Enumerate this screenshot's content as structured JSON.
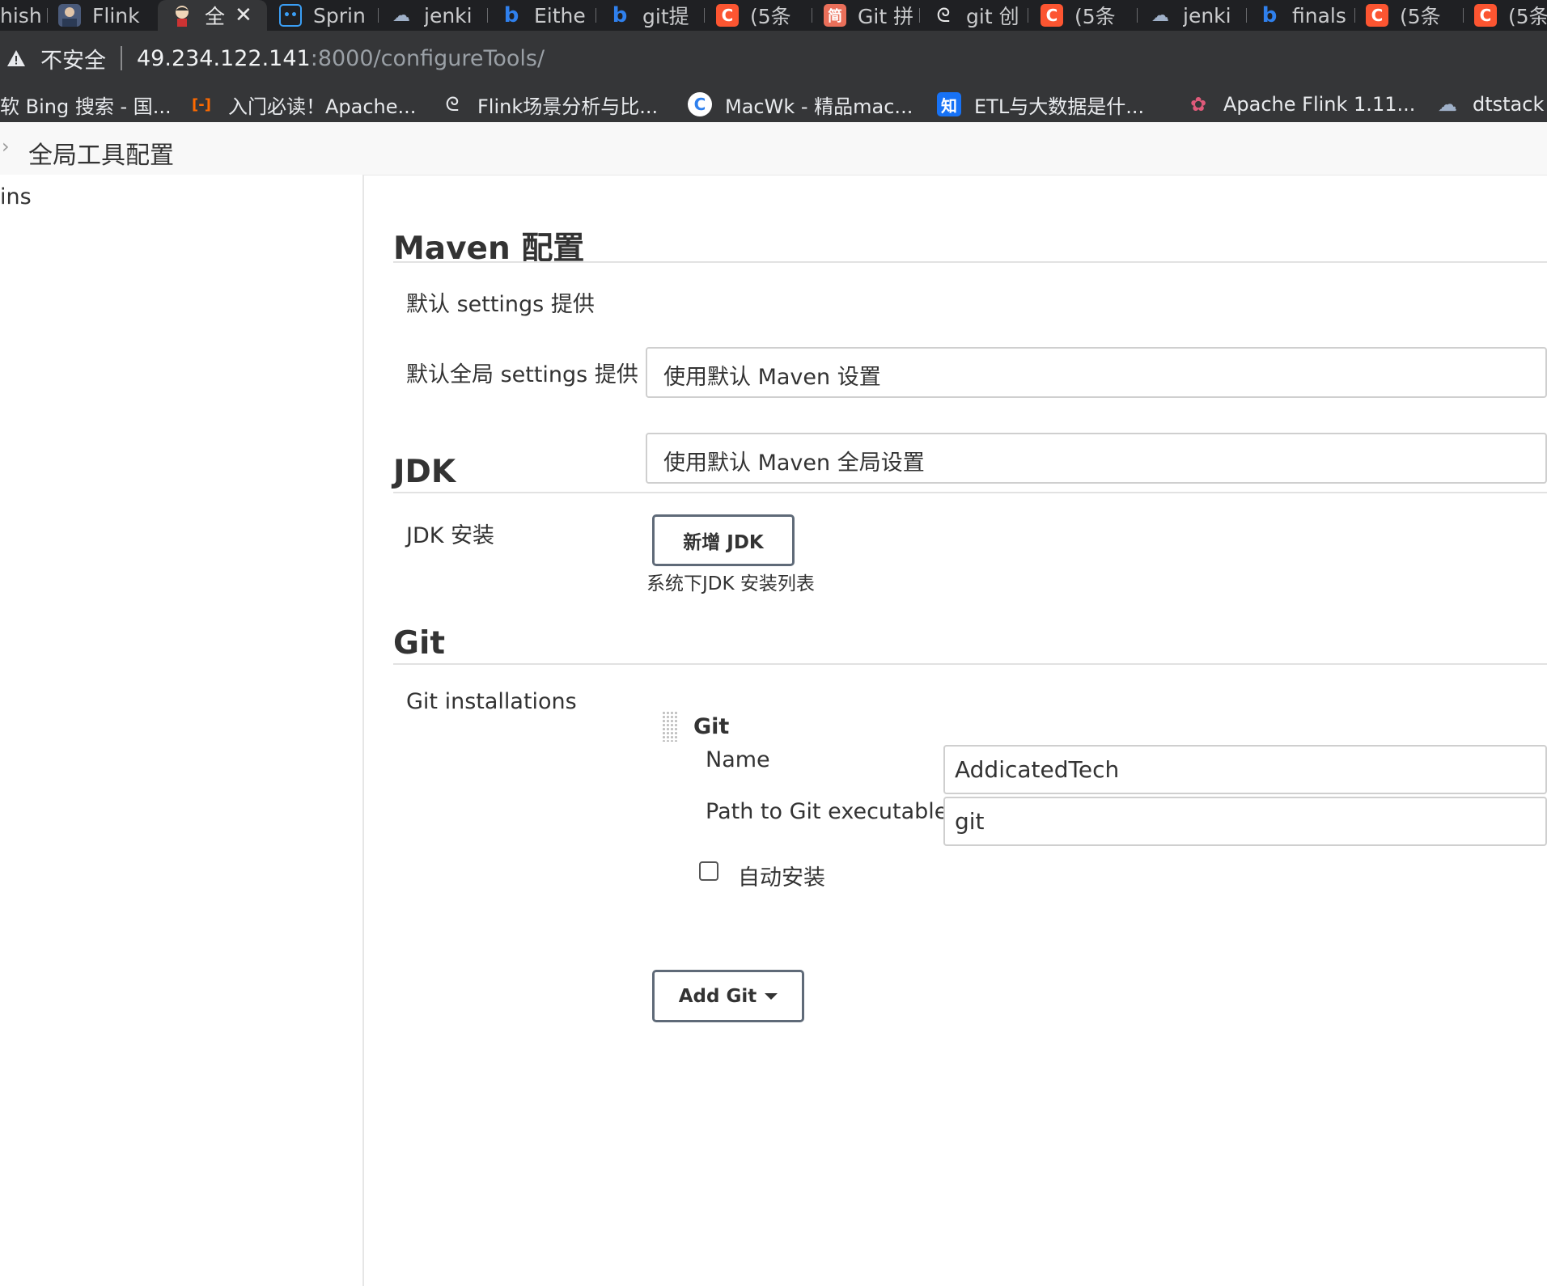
{
  "browser": {
    "tabs": [
      {
        "title": "hish",
        "icon": "page-icon",
        "icon_text": ""
      },
      {
        "title": "Flink",
        "icon": "avatar-icon",
        "icon_text": ""
      },
      {
        "title": "全",
        "icon": "jenkins-icon",
        "icon_text": "",
        "active": true
      },
      {
        "title": "Sprin",
        "icon": "bilibili-icon",
        "icon_text": "▣"
      },
      {
        "title": "jenki",
        "icon": "cloud-icon",
        "icon_text": "☁"
      },
      {
        "title": "Eithe",
        "icon": "bing-icon",
        "icon_text": "b"
      },
      {
        "title": "git提",
        "icon": "bing-icon",
        "icon_text": "b"
      },
      {
        "title": "(5条",
        "icon": "csdn-icon",
        "icon_text": "C"
      },
      {
        "title": "Git 拼",
        "icon": "jianshu-icon",
        "icon_text": "简"
      },
      {
        "title": "git 创",
        "icon": "flink-icon",
        "icon_text": "ᘓ"
      },
      {
        "title": "(5条",
        "icon": "csdn-icon",
        "icon_text": "C"
      },
      {
        "title": "jenki",
        "icon": "cloud-icon",
        "icon_text": "☁"
      },
      {
        "title": "finals",
        "icon": "bing-icon",
        "icon_text": "b"
      },
      {
        "title": "(5条",
        "icon": "csdn-icon",
        "icon_text": "C"
      },
      {
        "title": "(5条",
        "icon": "csdn-icon",
        "icon_text": "C"
      }
    ],
    "close_glyph": "✕",
    "address": {
      "insecure_label": "不安全",
      "host": "49.234.122.141",
      "rest": ":8000/configureTools/"
    },
    "bookmarks": [
      {
        "label": "软 Bing 搜索 - 国...",
        "icon": "",
        "icon_text": ""
      },
      {
        "label": "入门必读！Apache...",
        "icon": "aliyun-icon",
        "icon_text": "[-]"
      },
      {
        "label": "Flink场景分析与比...",
        "icon": "flink-icon",
        "icon_text": "ᘓ"
      },
      {
        "label": "MacWk - 精品mac...",
        "icon": "macwk-icon",
        "icon_text": "C"
      },
      {
        "label": "ETL与大数据是什...",
        "icon": "zhihu-icon",
        "icon_text": "知"
      },
      {
        "label": "Apache Flink 1.11...",
        "icon": "flink-squirrel-icon",
        "icon_text": "✿"
      },
      {
        "label": "dtstack",
        "icon": "cloud-icon",
        "icon_text": "☁"
      }
    ]
  },
  "header": {
    "breadcrumb_title": "全局工具配置",
    "chevron": "›"
  },
  "sidebar": {
    "text": "ins"
  },
  "maven": {
    "title": "Maven 配置",
    "settings_label": "默认 settings 提供",
    "settings_value": "使用默认 Maven 设置",
    "global_settings_label": "默认全局 settings 提供",
    "global_settings_value": "使用默认 Maven 全局设置"
  },
  "jdk": {
    "title": "JDK",
    "install_label": "JDK 安装",
    "add_button": "新增 JDK",
    "help": "系统下JDK 安装列表"
  },
  "git": {
    "title": "Git",
    "installations_label": "Git installations",
    "block_title": "Git",
    "name_label": "Name",
    "name_value": "AddicatedTech",
    "path_label": "Path to Git executable",
    "path_value": "git",
    "auto_install_label": "自动安装",
    "auto_install_checked": false,
    "add_button": "Add Git"
  },
  "colors": {
    "csdn": "#fc5531",
    "bing": "#2f80ed",
    "bilibili": "#3a9ef5",
    "zhihu": "#1772f6",
    "aliyun": "#ff6a00",
    "jianshu": "#ea6f5a"
  }
}
